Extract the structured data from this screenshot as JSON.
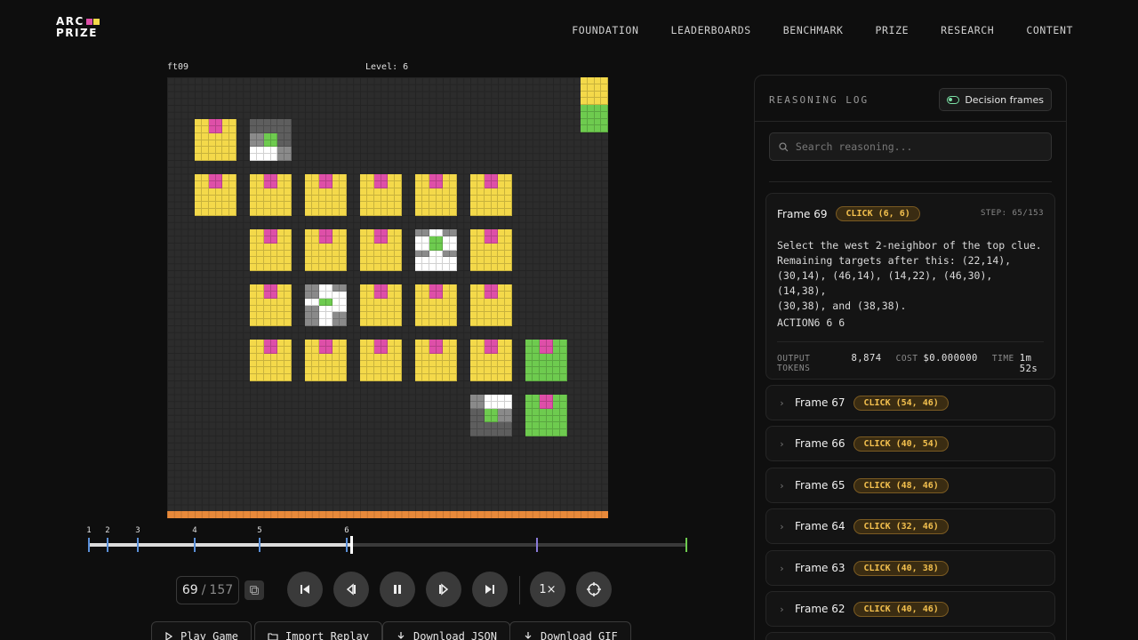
{
  "header": {
    "logo_line1": "ARC",
    "logo_line2": "PRIZE",
    "logo_colors": [
      "#de4fa8",
      "#f4d94a"
    ],
    "nav": [
      "FOUNDATION",
      "LEADERBOARDS",
      "BENCHMARK",
      "PRIZE",
      "RESEARCH",
      "CONTENT"
    ]
  },
  "game": {
    "id": "ft09",
    "level_label": "Level: 6",
    "colors": {
      "yellow": "#f4d94a",
      "magenta": "#de4fa8",
      "green": "#6ecb4f",
      "orange": "#e8893a",
      "board": "#2c2c2c"
    }
  },
  "timeline": {
    "markers": [
      "1",
      "2",
      "3",
      "4",
      "5",
      "6"
    ],
    "current_frame": 69,
    "total_frames": 157
  },
  "controls": {
    "current": "69",
    "separator": "/",
    "total": "157",
    "speed": "1×",
    "buttons": [
      "Play Game",
      "Import Replay",
      "Download JSON",
      "Download GIF"
    ]
  },
  "panel": {
    "title": "REASONING LOG",
    "toggle_label": "Decision frames",
    "search_placeholder": "Search reasoning...",
    "open_frame": {
      "title": "Frame 69",
      "action": "CLICK (6, 6)",
      "step": "STEP: 65/153",
      "reasoning": "Select the west 2-neighbor of the top clue.\nRemaining targets after this: (22,14),\n(30,14), (46,14), (14,22), (46,30), (14,38),\n(30,38), and (38,38).",
      "action_text": "ACTION6 6 6",
      "stats": {
        "tokens_label": "OUTPUT TOKENS",
        "tokens": "8,874",
        "cost_label": "COST",
        "cost": "$0.000000",
        "time_label": "TIME",
        "time": "1m 52s"
      }
    },
    "frames": [
      {
        "title": "Frame 67",
        "action": "CLICK (54, 46)"
      },
      {
        "title": "Frame 66",
        "action": "CLICK (40, 54)"
      },
      {
        "title": "Frame 65",
        "action": "CLICK (48, 46)"
      },
      {
        "title": "Frame 64",
        "action": "CLICK (32, 46)"
      },
      {
        "title": "Frame 63",
        "action": "CLICK (40, 38)"
      },
      {
        "title": "Frame 62",
        "action": "CLICK (40, 46)"
      }
    ]
  }
}
